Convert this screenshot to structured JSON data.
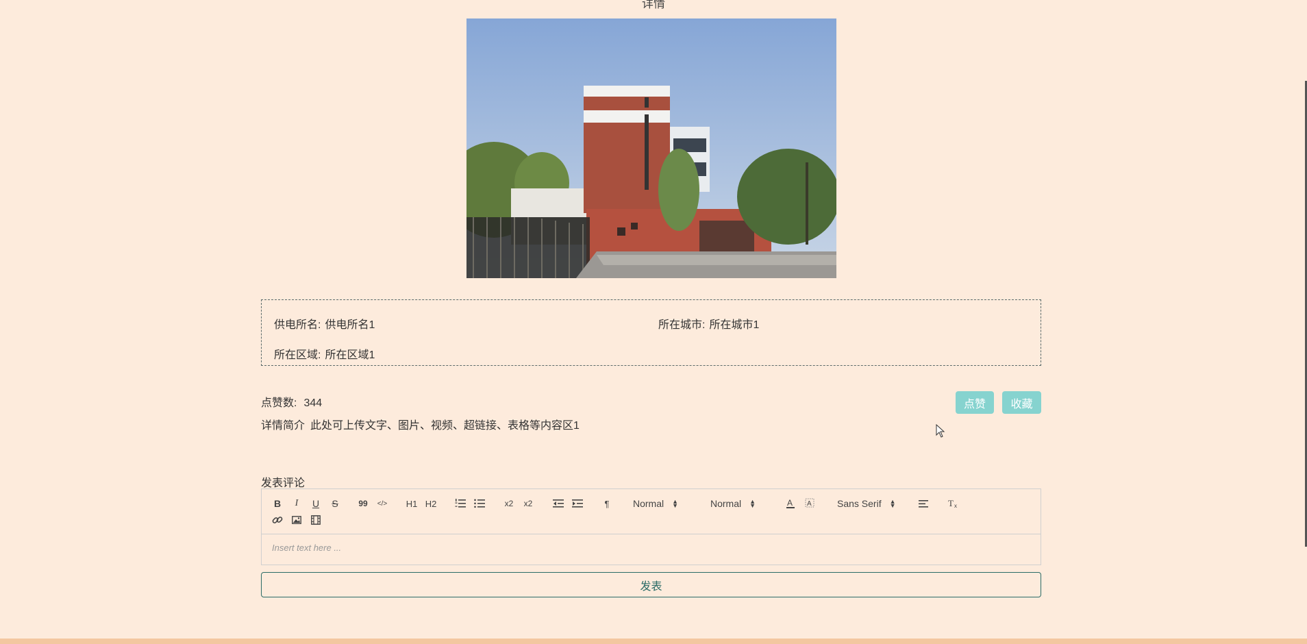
{
  "page": {
    "title": "详情"
  },
  "info": {
    "station_label": "供电所名:",
    "station_value": "供电所名1",
    "city_label": "所在城市:",
    "city_value": "所在城市1",
    "district_label": "所在区域:",
    "district_value": "所在区域1"
  },
  "stats": {
    "likes_label": "点赞数:",
    "likes_value": "344",
    "intro_label": "详情简介",
    "intro_value": "此处可上传文字、图片、视频、超链接、表格等内容区1"
  },
  "actions": {
    "like_label": "点赞",
    "favorite_label": "收藏"
  },
  "comment": {
    "label": "发表评论",
    "placeholder": "Insert text here ...",
    "submit_label": "发表",
    "toolbar": {
      "header_select": "Normal",
      "size_select": "Normal",
      "font_select": "Sans Serif",
      "bold_glyph": "B",
      "italic_glyph": "I",
      "underline_glyph": "U",
      "strike_glyph": "S",
      "quote_glyph": "99",
      "code_glyph": "</>",
      "h1_glyph": "H1",
      "h2_glyph": "H2",
      "sub_glyph": "x2",
      "sup_glyph": "x2",
      "direction_glyph": "¶"
    }
  },
  "colors": {
    "background": "#fdebdc",
    "button_teal": "#86d3cf",
    "submit_border": "#2a6b66",
    "bottom_bar": "#f3c7a0"
  },
  "icons": [
    "bold-icon",
    "italic-icon",
    "underline-icon",
    "strike-icon",
    "blockquote-icon",
    "code-block-icon",
    "header1-icon",
    "header2-icon",
    "ordered-list-icon",
    "bullet-list-icon",
    "subscript-icon",
    "superscript-icon",
    "outdent-icon",
    "indent-icon",
    "text-direction-icon",
    "text-color-icon",
    "background-color-icon",
    "align-icon",
    "clear-format-icon",
    "link-icon",
    "image-icon",
    "video-icon"
  ]
}
